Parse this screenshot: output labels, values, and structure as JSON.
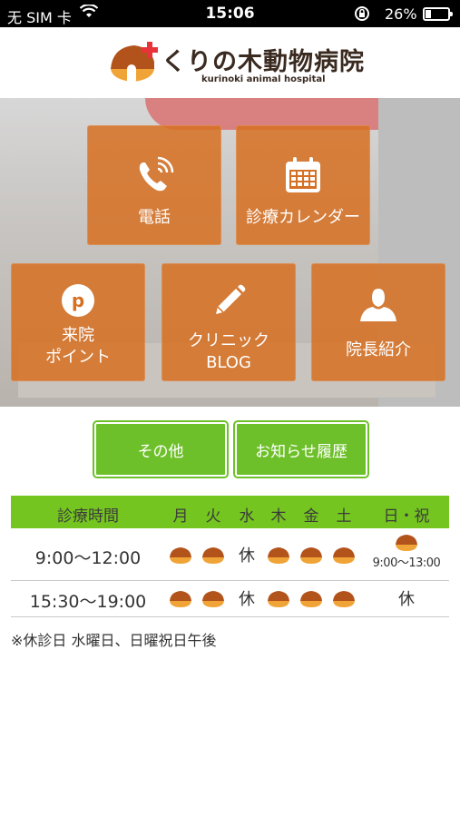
{
  "status_bar": {
    "carrier": "无 SIM 卡",
    "time": "15:06",
    "battery": "26%",
    "battery_level": 0.26
  },
  "header": {
    "logo_name": "くりの木動物病院",
    "logo_sub": "kurinoki animal hospital"
  },
  "menu": {
    "phone": "電話",
    "calendar": "診療カレンダー",
    "points_line1": "来院",
    "points_line2": "ポイント",
    "points_icon_letter": "p",
    "blog_line1": "クリニック",
    "blog_line2": "BLOG",
    "director": "院長紹介"
  },
  "buttons": {
    "other": "その他",
    "news": "お知らせ履歴"
  },
  "schedule": {
    "header": [
      "診療時間",
      "月",
      "火",
      "水",
      "木",
      "金",
      "土",
      "日・祝"
    ],
    "rows": [
      {
        "time": "9:00〜12:00",
        "closed_label": "休",
        "sunday_hours": "9:00〜13:00"
      },
      {
        "time": "15:30〜19:00",
        "closed_label": "休",
        "sunday_label": "休"
      }
    ]
  },
  "note": "※休診日 水曜日、日曜祝日午後",
  "colors": {
    "tile": "#d67022",
    "green": "#6ec02a",
    "chestnut": "#b3531c"
  }
}
